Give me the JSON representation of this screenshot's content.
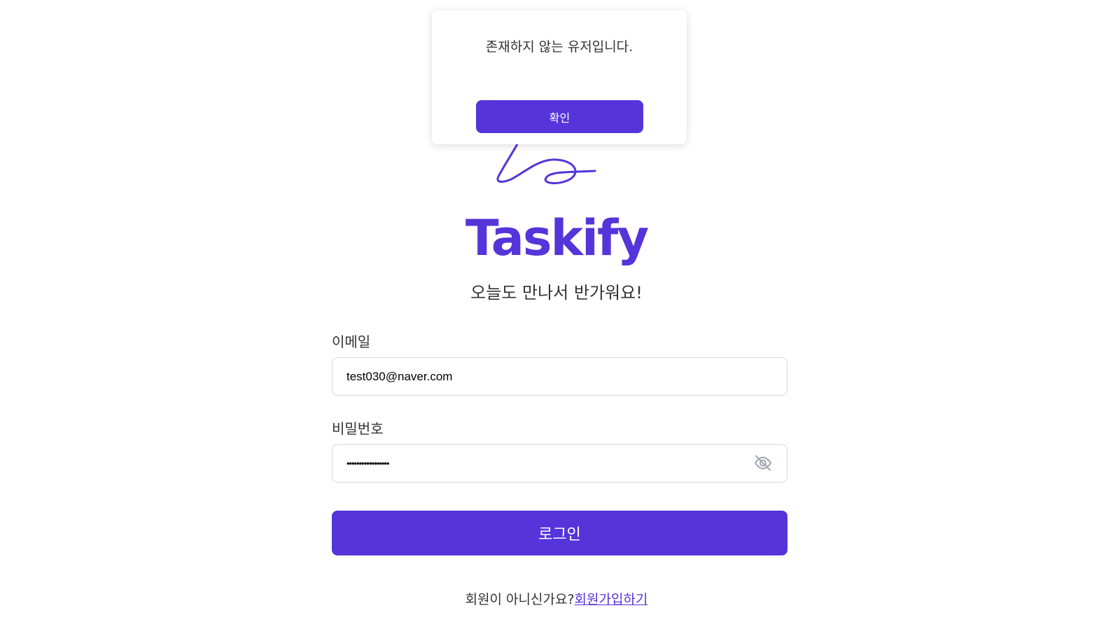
{
  "brand": {
    "name": "Taskify",
    "tagline": "오늘도 만나서 반가워요!",
    "color": "#5534DA"
  },
  "form": {
    "email": {
      "label": "이메일",
      "value": "test030@naver.com"
    },
    "password": {
      "label": "비밀번호",
      "masked_value": "•••••••••••••••••",
      "toggle_icon": "eye-off-icon"
    },
    "submit_label": "로그인"
  },
  "signup": {
    "prompt": "회원이 아니신가요?",
    "link_label": "회원가입하기"
  },
  "modal": {
    "message": "존재하지 않는 유저입니다.",
    "confirm_label": "확인"
  }
}
